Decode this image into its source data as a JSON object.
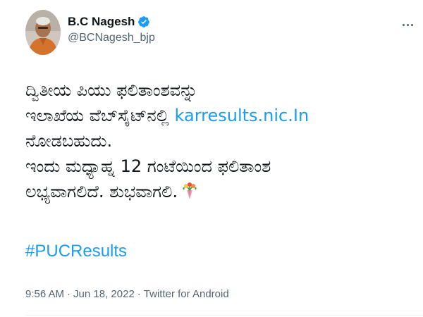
{
  "author": {
    "name": "B.C Nagesh",
    "handle": "@BCNagesh_bjp",
    "verified": true
  },
  "tweet": {
    "line1": "ದ್ವಿತೀಯ ಪಿಯು ಫಲಿತಾಂಶವನ್ನು",
    "line2_text": "ಇಲಾಖೆಯ ವೆಬ್‌ಸೈಟ್‌ನಲ್ಲಿ ",
    "line2_link": "karresults.nic.In",
    "line3": "ನೋಡಬಹುದು.",
    "line4": "ಇಂದು ಮಧ್ಯಾಹ್ನ 12 ಗಂಟೆಯಿಂದ ಫಲಿತಾಂಶ",
    "line5": "ಲಭ್ಯವಾಗಲಿದೆ. ಶುಭವಾಗಲಿ.",
    "emoji": "bouquet-icon",
    "hashtag": "#PUCResults"
  },
  "meta": {
    "time": "9:56 AM",
    "separator": "·",
    "date": "Jun 18, 2022",
    "source": "Twitter for Android"
  },
  "colors": {
    "link": "#1d9bf0",
    "verified": "#1d9bf0",
    "secondary_text": "#536471"
  }
}
